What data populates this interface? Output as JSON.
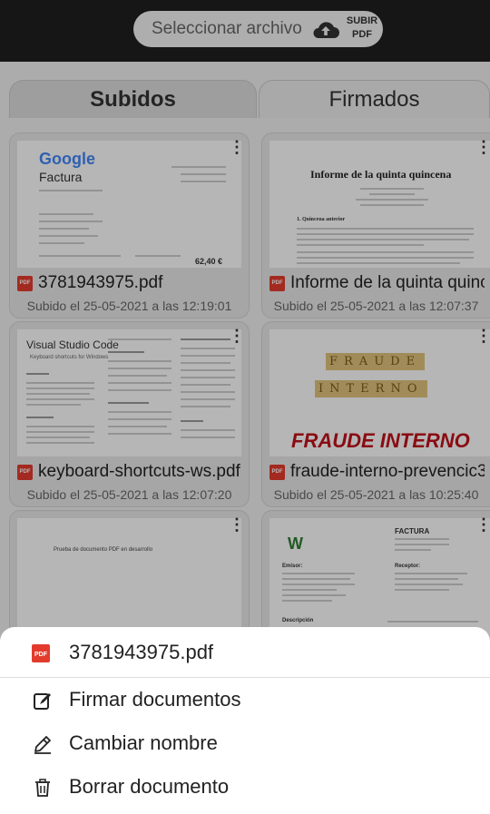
{
  "upload_bar": {
    "select_file_label": "Seleccionar archivo",
    "upload_label_line1": "SUBIR",
    "upload_label_line2": "PDF"
  },
  "tabs": [
    {
      "label": "Subidos",
      "active": true
    },
    {
      "label": "Firmados",
      "active": false
    }
  ],
  "documents": [
    {
      "name": "3781943975.pdf",
      "date": "Subido el 25-05-2021 a las 12:19:01",
      "preview": {
        "logo": "Google",
        "heading": "Factura",
        "total": "62,40 €"
      }
    },
    {
      "name": "Informe de la quinta quinc...",
      "date": "Subido el 25-05-2021 a las 12:07:37",
      "preview": {
        "heading": "Informe de la quinta quincena",
        "section": "1.  Quincena anterior"
      }
    },
    {
      "name": "keyboard-shortcuts-ws.pdf",
      "date": "Subido el 25-05-2021 a las 12:07:20",
      "preview": {
        "logo": "Visual Studio Code",
        "subtitle": "Keyboard shortcuts for Windows"
      }
    },
    {
      "name": "fraude-interno-prevencic3...",
      "date": "Subido el 25-05-2021 a las 10:25:40",
      "preview": {
        "tiles_line1": "FRAUDE",
        "tiles_line2": "INTERNO",
        "heading": "FRAUDE INTERNO"
      }
    },
    {
      "name": "",
      "date": "",
      "preview": {
        "text": "Prueba de documento PDF en desarrollo"
      }
    },
    {
      "name": "",
      "date": "",
      "preview": {
        "logo": "W",
        "heading": "FACTURA",
        "emisor": "Emisor:",
        "receptor": "Receptor:",
        "descripcion": "Descripción"
      }
    }
  ],
  "bottom_sheet": {
    "file_name": "3781943975.pdf",
    "actions": [
      {
        "label": "Firmar documentos",
        "icon": "sign-icon"
      },
      {
        "label": "Cambiar nombre",
        "icon": "pencil-icon"
      },
      {
        "label": "Borrar documento",
        "icon": "trash-icon"
      }
    ]
  },
  "colors": {
    "pdf_badge": "#e23b2e",
    "top_bar": "#1f1f1f",
    "fraude_text": "#c0101a"
  }
}
